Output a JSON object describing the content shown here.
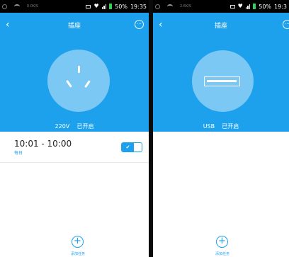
{
  "colors": {
    "accent": "#1ea1ec",
    "background": "#ffffff",
    "statusbar": "#000000"
  },
  "statusbar_left": {
    "speed": "0.0K/S",
    "battery_pct": "50%",
    "time": "19:35"
  },
  "statusbar_right": {
    "speed": "2.6K/S",
    "battery_pct": "50%",
    "time": "19:3"
  },
  "screen_left": {
    "title": "插座",
    "back_icon": "back-arrow",
    "more_icon": "more-dots",
    "device_icon": "power-socket",
    "voltage": "220V",
    "status": "已开启",
    "pager": {
      "count": 2,
      "active": 1
    },
    "timer": {
      "time": "10:01 - 10:00",
      "repeat": "每日",
      "toggle_icon": "checkmark",
      "enabled": true
    },
    "add_label": "添加任务"
  },
  "screen_right": {
    "title": "插座",
    "back_icon": "back-arrow",
    "more_icon": "more-dots",
    "device_icon": "usb-port",
    "port": "USB",
    "status": "已开启",
    "pager": {
      "count": 2,
      "active": 2
    },
    "add_label": "添加任务"
  }
}
